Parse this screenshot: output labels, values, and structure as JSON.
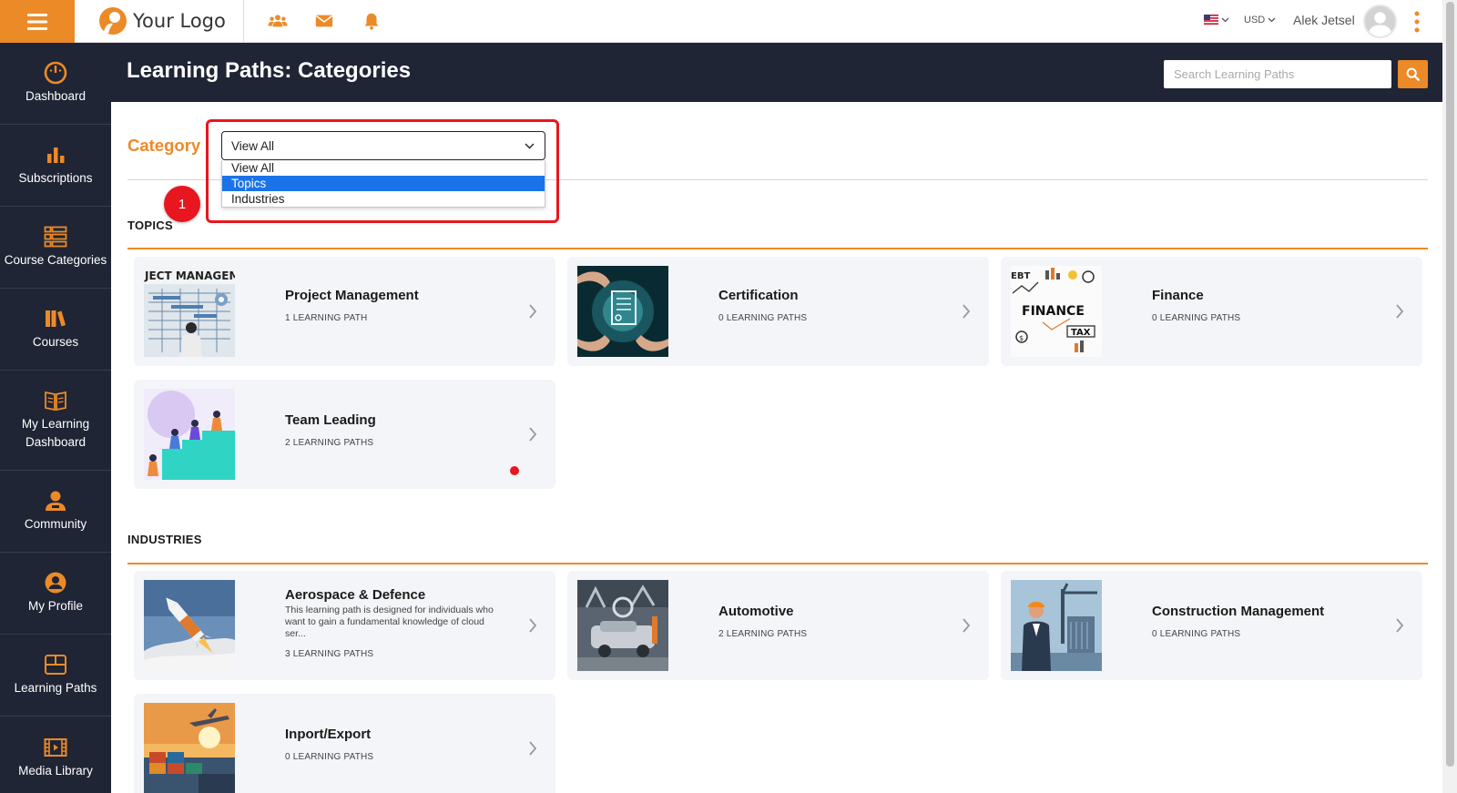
{
  "topbar": {
    "logo_text": "Your Logo",
    "currency": "USD",
    "user_name": "Alek Jetsel"
  },
  "sidebar": {
    "items": [
      {
        "label": "Dashboard",
        "icon": "dashboard-gauge-icon"
      },
      {
        "label": "Subscriptions",
        "icon": "bar-chart-icon"
      },
      {
        "label": "Course Categories",
        "icon": "list-categories-icon"
      },
      {
        "label": "Courses",
        "icon": "books-icon"
      },
      {
        "label": "My Learning Dashboard",
        "icon": "open-book-icon"
      },
      {
        "label": "Community",
        "icon": "community-user-icon"
      },
      {
        "label": "My Profile",
        "icon": "profile-user-icon"
      },
      {
        "label": "Learning Paths",
        "icon": "learning-paths-icon"
      },
      {
        "label": "Media Library",
        "icon": "film-icon"
      }
    ]
  },
  "header": {
    "title": "Learning Paths: Categories",
    "search_placeholder": "Search Learning Paths"
  },
  "filter": {
    "label": "Category",
    "selected": "View All",
    "options": [
      "View All",
      "Topics",
      "Industries"
    ],
    "highlighted_option": "Topics",
    "step_number": "1"
  },
  "sections": [
    {
      "title": "TOPICS",
      "cards": [
        {
          "title": "Project Management",
          "count": "1 LEARNING PATH",
          "thumb": "project-management-image"
        },
        {
          "title": "Certification",
          "count": "0 LEARNING PATHS",
          "thumb": "certification-image"
        },
        {
          "title": "Finance",
          "count": "0 LEARNING PATHS",
          "thumb": "finance-image"
        },
        {
          "title": "Team Leading",
          "count": "2 LEARNING PATHS",
          "thumb": "team-leading-image"
        }
      ]
    },
    {
      "title": "INDUSTRIES",
      "cards": [
        {
          "title": "Aerospace & Defence",
          "description": "This learning path is designed for individuals who want to gain a fundamental knowledge of cloud ser...",
          "count": "3 LEARNING PATHS",
          "thumb": "rocket-image"
        },
        {
          "title": "Automotive",
          "count": "2 LEARNING PATHS",
          "thumb": "automotive-factory-image"
        },
        {
          "title": "Construction Management",
          "count": "0 LEARNING PATHS",
          "thumb": "construction-image"
        },
        {
          "title": "Inport/Export",
          "count": "0 LEARNING PATHS",
          "thumb": "shipping-port-image"
        }
      ]
    }
  ],
  "colors": {
    "accent": "#ec8a28",
    "navy": "#1f2535",
    "highlight_red": "#e8161e",
    "select_blue": "#1a73e8"
  }
}
